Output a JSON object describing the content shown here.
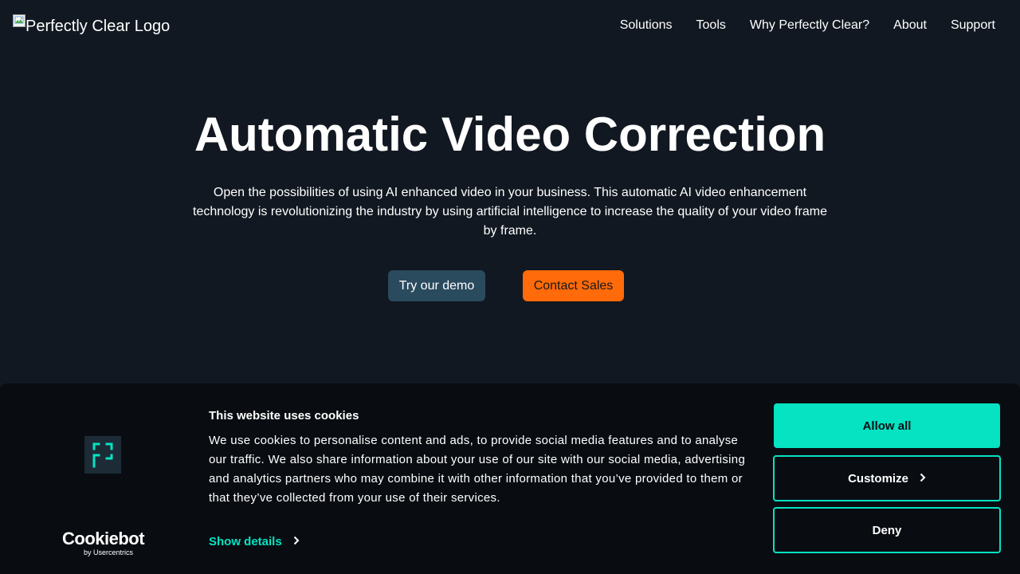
{
  "header": {
    "logo_alt": "Perfectly Clear Logo",
    "nav": [
      {
        "label": "Solutions"
      },
      {
        "label": "Tools"
      },
      {
        "label": "Why Perfectly Clear?"
      },
      {
        "label": "About"
      },
      {
        "label": "Support"
      }
    ]
  },
  "hero": {
    "title": "Automatic Video Correction",
    "description": "Open the possibilities of using AI enhanced video in your business. This automatic AI video enhancement technology is revolutionizing the industry by using artificial intelligence to increase the quality of your video frame by frame.",
    "demo_button": "Try our demo",
    "sales_button": "Contact Sales"
  },
  "cookie_banner": {
    "title": "This website uses cookies",
    "text": "We use cookies to personalise content and ads, to provide social media features and to analyse our traffic. We also share information about your use of our site with our social media, advertising and analytics partners who may combine it with other information that you’ve provided to them or that they’ve collected from your use of their services.",
    "show_details": "Show details",
    "allow_all": "Allow all",
    "customize": "Customize",
    "deny": "Deny",
    "brand_name": "Cookiebot",
    "brand_sub": "by Usercentrics"
  },
  "colors": {
    "background": "#111821",
    "banner_bg": "#090d12",
    "accent": "#05e3c2",
    "demo_button": "#2a4a5e",
    "sales_button": "#ff6a0a"
  },
  "icons": [
    "broken-image-icon",
    "perfectly-clear-mark-icon",
    "chevron-right-icon"
  ]
}
